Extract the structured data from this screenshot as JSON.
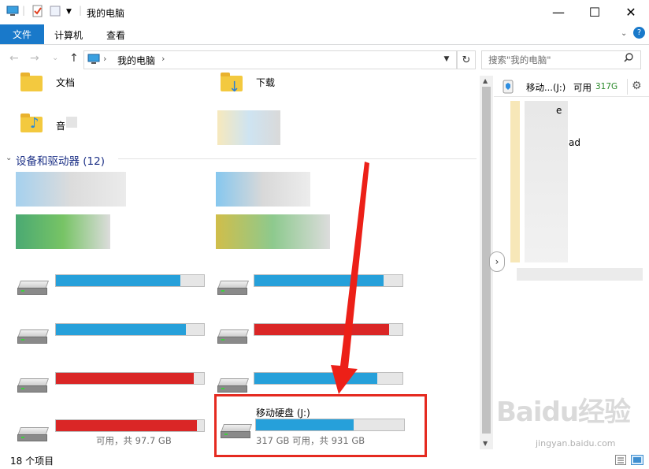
{
  "window": {
    "title": "我的电脑",
    "controls": {
      "minimize": "—",
      "maximize": "☐",
      "close": "✕"
    }
  },
  "ribbon": {
    "tabs": [
      "文件",
      "计算机",
      "查看"
    ],
    "expand_icon": "chevron-down-icon",
    "help": "?"
  },
  "nav": {
    "back": "←",
    "forward": "→",
    "recent": "⌄",
    "up": "↑",
    "breadcrumb": [
      "我的电脑"
    ],
    "separator": "›",
    "refresh": "↻",
    "search_placeholder": "搜索\"我的电脑\""
  },
  "folders": [
    {
      "label": "文档",
      "icon": "documents-folder-icon"
    },
    {
      "label": "下载",
      "icon": "downloads-folder-icon"
    },
    {
      "label": "音",
      "icon": "music-folder-icon"
    }
  ],
  "devices": {
    "header": "设备和驱动器 (12)",
    "highlighted_drive": {
      "name": "移动硬盘 (J:)",
      "space_text": "317 GB 可用，共 931 GB",
      "fill_fraction": 0.66
    },
    "partial_left_text": "可用，共 97.7 GB",
    "bar_colors": {
      "normal": "#26a0da",
      "full": "#da2626"
    }
  },
  "preview": {
    "title": "移动...(J:)",
    "free_label": "可用",
    "free_size": "317G",
    "partial_text_1": "e",
    "partial_text_2": "ad"
  },
  "status": {
    "item_count": "18 个项目"
  },
  "annotations": {
    "watermark": "Baidu经验",
    "watermark_url": "jingyan.baidu.com"
  }
}
